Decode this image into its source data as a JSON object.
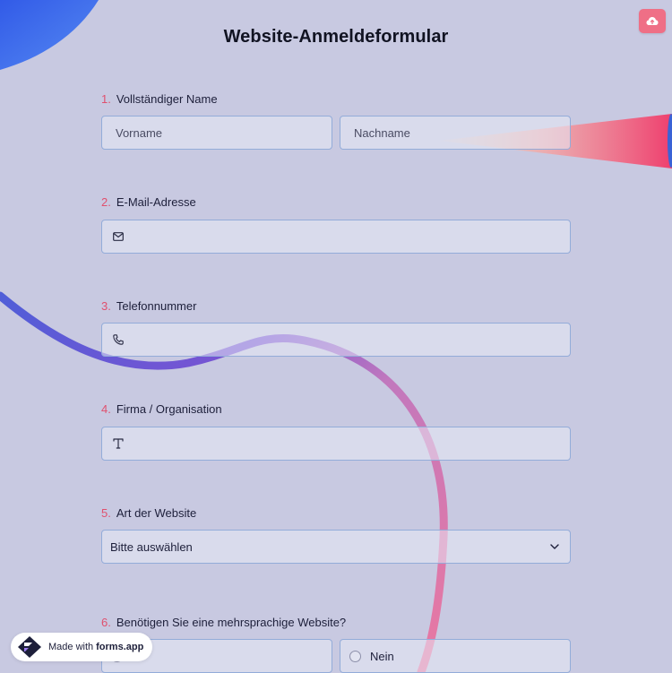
{
  "form": {
    "title": "Website-Anmeldeformular"
  },
  "questions": [
    {
      "number": "1.",
      "label": "Vollständiger Name"
    },
    {
      "number": "2.",
      "label": "E-Mail-Adresse"
    },
    {
      "number": "3.",
      "label": "Telefonnummer"
    },
    {
      "number": "4.",
      "label": "Firma / Organisation"
    },
    {
      "number": "5.",
      "label": "Art der Website"
    },
    {
      "number": "6.",
      "label": "Benötigen Sie eine mehrsprachige Website?"
    }
  ],
  "fields": {
    "first_name_placeholder": "Vorname",
    "last_name_placeholder": "Nachname",
    "website_type_value": "Bitte auswählen",
    "option_no": "Nein"
  },
  "icons": {
    "upload": "cloud-upload-icon",
    "email": "envelope-icon",
    "phone": "phone-icon",
    "text": "text-t-icon",
    "dropdown": "chevron-down-icon"
  },
  "colors": {
    "background": "#c8c9e1",
    "accent": "#e0506e",
    "field_border": "#93acd9",
    "upload_button": "#ef6f86"
  },
  "badge": {
    "prefix": "Made with",
    "brand": "forms.app"
  }
}
